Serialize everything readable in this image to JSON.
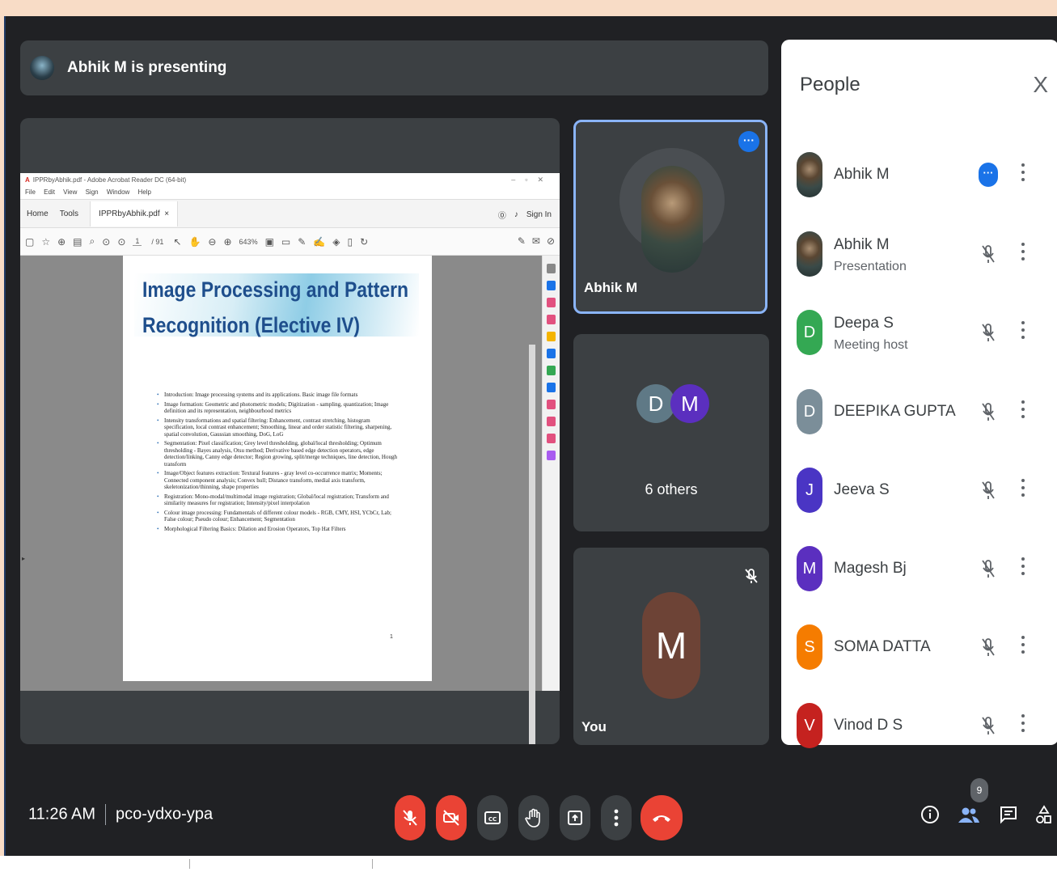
{
  "presenter": {
    "text": "Abhik M is presenting"
  },
  "acrobat": {
    "window_title": "IPPRbyAbhik.pdf - Adobe Acrobat Reader DC (64-bit)",
    "menu": [
      "File",
      "Edit",
      "View",
      "Sign",
      "Window",
      "Help"
    ],
    "tabs": {
      "home": "Home",
      "tools": "Tools",
      "doc": "IPPRbyAbhik.pdf"
    },
    "sign_in": "Sign In",
    "page_current": "1",
    "page_total": "/ 91",
    "zoom": "643%"
  },
  "slide": {
    "title_line1": "Image Processing and Pattern",
    "title_line2": "Recognition (Elective IV)",
    "bullets": [
      "Introduction: Image processing systems and its applications. Basic image file formats",
      "Image formation: Geometric and photometric models; Digitization - sampling, quantization; Image definition and its representation, neighbourhood metrics",
      "Intensity transformations and spatial filtering: Enhancement, contrast stretching, histogram specification, local contrast enhancement; Smoothing, linear and order statistic filtering, sharpening, spatial convolution, Gaussian smoothing, DoG, LoG",
      "Segmentation: Pixel classification; Grey level thresholding, global/local thresholding; Optimum thresholding - Bayes analysis, Otsu method; Derivative based edge detection operators, edge detection/linking, Canny edge detector; Region growing, split/merge techniques, line detection, Hough transform",
      "Image/Object features extraction: Textural features - gray level co-occurrence matrix; Moments; Connected component analysis; Convex hull; Distance transform, medial axis transform, skeletonization/thinning, shape properties",
      "Registration: Mono-modal/multimodal image registration; Global/local registration; Transform and similarity measures for registration; Intensity/pixel interpolation",
      "Colour image processing: Fundamentals of different colour models - RGB, CMY, HSI, YCbCr, Lab; False colour; Pseudo colour; Enhancement; Segmentation",
      "Morphological Filtering Basics: Dilation and Erosion Operators, Top Hat Filters"
    ],
    "page_number": "1"
  },
  "tiles": {
    "abhik": {
      "name": "Abhik M"
    },
    "others": {
      "initial1": "D",
      "initial2": "M",
      "label": "6 others"
    },
    "you": {
      "initial": "M",
      "label": "You"
    }
  },
  "people": {
    "title": "People",
    "close": "X",
    "list": [
      {
        "name": "Abhik M",
        "sub": "",
        "initial": "",
        "color": ""
      },
      {
        "name": "Abhik M",
        "sub": "Presentation",
        "initial": "",
        "color": ""
      },
      {
        "name": "Deepa S",
        "sub": "Meeting host",
        "initial": "D",
        "color": "#34a853"
      },
      {
        "name": "DEEPIKA GUPTA",
        "sub": "",
        "initial": "D",
        "color": "#7b8e99"
      },
      {
        "name": "Jeeva S",
        "sub": "",
        "initial": "J",
        "color": "#4a35c4"
      },
      {
        "name": "Magesh Bj",
        "sub": "",
        "initial": "M",
        "color": "#5b2fbf"
      },
      {
        "name": "SOMA DATTA",
        "sub": "",
        "initial": "S",
        "color": "#f57c00"
      },
      {
        "name": "Vinod D S",
        "sub": "",
        "initial": "V",
        "color": "#c5221f"
      }
    ]
  },
  "bottom": {
    "time": "11:26 AM",
    "meeting_code": "pco-ydxo-ypa",
    "people_count": "9"
  },
  "colors": {
    "bg": "#202124",
    "tile": "#3c4043",
    "accent": "#1a73e8",
    "danger": "#ea4335"
  }
}
